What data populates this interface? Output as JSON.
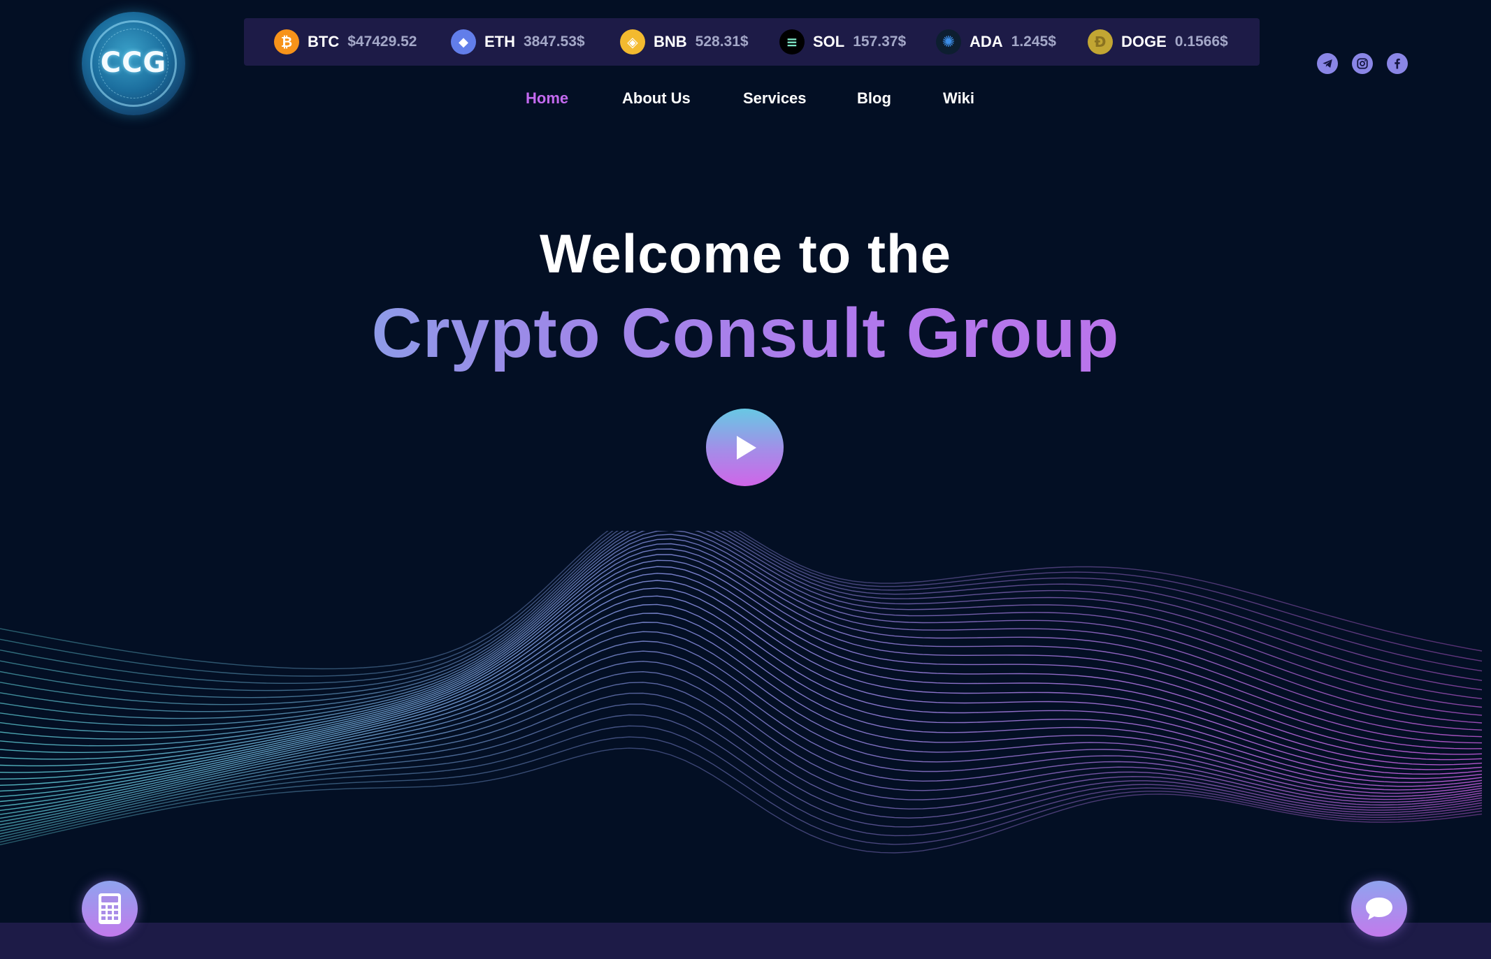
{
  "logo": {
    "text": "CCG"
  },
  "ticker": [
    {
      "symbol": "BTC",
      "price": "$47429.52",
      "icon": "bitcoin-icon",
      "color": "#f7931a",
      "glyph": "₿"
    },
    {
      "symbol": "ETH",
      "price": "3847.53$",
      "icon": "ethereum-icon",
      "color": "#627eea",
      "glyph": "◆"
    },
    {
      "symbol": "BNB",
      "price": "528.31$",
      "icon": "bnb-icon",
      "color": "#f3ba2f",
      "glyph": "◈"
    },
    {
      "symbol": "SOL",
      "price": "157.37$",
      "icon": "solana-icon",
      "color": "#000000",
      "glyph": "≡"
    },
    {
      "symbol": "ADA",
      "price": "1.245$",
      "icon": "cardano-icon",
      "color": "#0d1e30",
      "glyph": "✺"
    },
    {
      "symbol": "DOGE",
      "price": "0.1566$",
      "icon": "dogecoin-icon",
      "color": "#c2a633",
      "glyph": "Ð"
    }
  ],
  "nav": {
    "home": "Home",
    "about": "About Us",
    "services": "Services",
    "blog": "Blog",
    "wiki": "Wiki"
  },
  "socials": [
    "telegram-icon",
    "instagram-icon",
    "facebook-icon"
  ],
  "hero": {
    "line1": "Welcome to the",
    "line2": "Crypto Consult Group"
  },
  "colors": {
    "background": "#030f24",
    "panel": "#1d1b47",
    "accent": "#c46af0",
    "wave_start": "#5fd0d8",
    "wave_mid": "#9a8ae8",
    "wave_end": "#d061e6"
  }
}
